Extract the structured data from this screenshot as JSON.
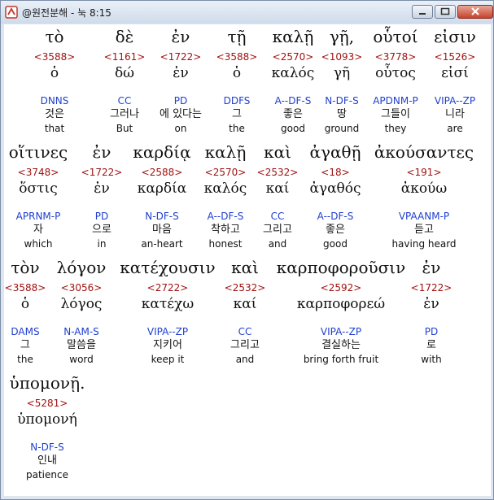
{
  "window": {
    "title": "@원전분해 - 눅 8:15"
  },
  "rows": [
    [
      {
        "greek": "τὸ",
        "strong": "<3588>",
        "lemma": "ὁ",
        "parse": "DNNS",
        "korean": "것은",
        "english": "that"
      },
      {
        "greek": "δὲ",
        "strong": "<1161>",
        "lemma": "δώ",
        "parse": "CC",
        "korean": "그러나",
        "english": "But"
      },
      {
        "greek": "ἐν",
        "strong": "<1722>",
        "lemma": "ἐν",
        "parse": "PD",
        "korean": "에 있다는",
        "english": "on"
      },
      {
        "greek": "τῇ",
        "strong": "<3588>",
        "lemma": "ὁ",
        "parse": "DDFS",
        "korean": "그",
        "english": "the"
      },
      {
        "greek": "καλῇ",
        "strong": "<2570>",
        "lemma": "καλός",
        "parse": "A--DF-S",
        "korean": "좋은",
        "english": "good"
      },
      {
        "greek": "γῇ,",
        "strong": "<1093>",
        "lemma": "γῆ",
        "parse": "N-DF-S",
        "korean": "땅",
        "english": "ground"
      },
      {
        "greek": "οὗτοί",
        "strong": "<3778>",
        "lemma": "οὗτος",
        "parse": "APDNM-P",
        "korean": "그들이",
        "english": "they"
      },
      {
        "greek": "εἰσιν",
        "strong": "<1526>",
        "lemma": "εἰσί",
        "parse": "VIPA--ZP",
        "korean": "니라",
        "english": "are"
      }
    ],
    [
      {
        "greek": "οἵτινες",
        "strong": "<3748>",
        "lemma": "ὅστις",
        "parse": "APRNM-P",
        "korean": "자",
        "english": "which"
      },
      {
        "greek": "ἐν",
        "strong": "<1722>",
        "lemma": "ἐν",
        "parse": "PD",
        "korean": "으로",
        "english": "in"
      },
      {
        "greek": "καρδίᾳ",
        "strong": "<2588>",
        "lemma": "καρδία",
        "parse": "N-DF-S",
        "korean": "마음",
        "english": "an-heart"
      },
      {
        "greek": "καλῇ",
        "strong": "<2570>",
        "lemma": "καλός",
        "parse": "A--DF-S",
        "korean": "착하고",
        "english": "honest"
      },
      {
        "greek": "καὶ",
        "strong": "<2532>",
        "lemma": "καί",
        "parse": "CC",
        "korean": "그리고",
        "english": "and"
      },
      {
        "greek": "ἀγαθῇ",
        "strong": "<18>",
        "lemma": "ἀγαθός",
        "parse": "A--DF-S",
        "korean": "좋은",
        "english": "good"
      },
      {
        "greek": "ἀκούσαντες",
        "strong": "<191>",
        "lemma": "ἀκούω",
        "parse": "VPAANM-P",
        "korean": "듣고",
        "english": "having heard"
      }
    ],
    [
      {
        "greek": "τὸν",
        "strong": "<3588>",
        "lemma": "ὁ",
        "parse": "DAMS",
        "korean": "그",
        "english": "the"
      },
      {
        "greek": "λόγον",
        "strong": "<3056>",
        "lemma": "λόγος",
        "parse": "N-AM-S",
        "korean": "말씀을",
        "english": "word"
      },
      {
        "greek": "κατέχουσιν",
        "strong": "<2722>",
        "lemma": "κατέχω",
        "parse": "VIPA--ZP",
        "korean": "지키어",
        "english": "keep it"
      },
      {
        "greek": "καὶ",
        "strong": "<2532>",
        "lemma": "καί",
        "parse": "CC",
        "korean": "그리고",
        "english": "and"
      },
      {
        "greek": "καρποφοροῦσιν",
        "strong": "<2592>",
        "lemma": "καρποφορεώ",
        "parse": "VIPA--ZP",
        "korean": "결실하는",
        "english": "bring forth fruit"
      },
      {
        "greek": "ἐν",
        "strong": "<1722>",
        "lemma": "ἐν",
        "parse": "PD",
        "korean": "로",
        "english": "with"
      }
    ],
    [
      {
        "greek": "ὑπομονῇ.",
        "strong": "<5281>",
        "lemma": "ὑπομονή",
        "parse": "N-DF-S",
        "korean": "인내",
        "english": "patience"
      }
    ]
  ]
}
